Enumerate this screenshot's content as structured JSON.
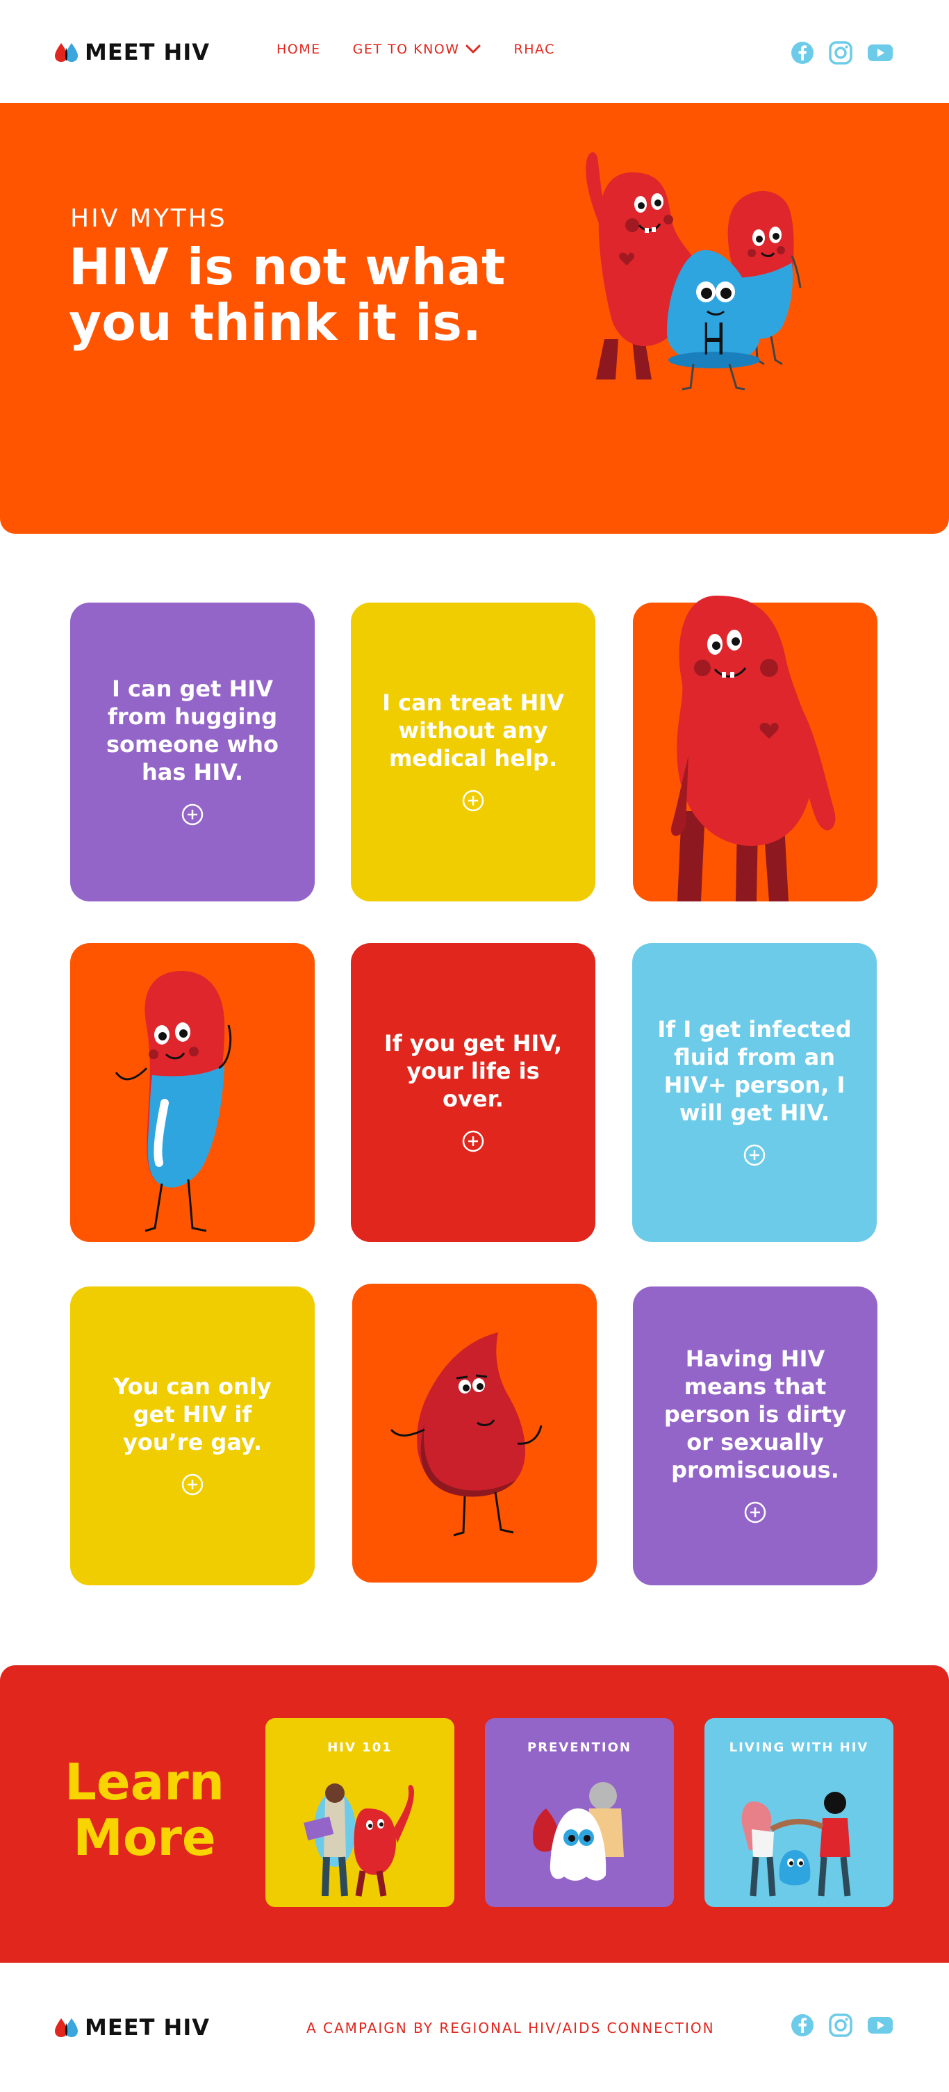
{
  "header": {
    "brand": "MEET HIV",
    "nav": [
      {
        "label": "HOME"
      },
      {
        "label": "GET TO KNOW"
      },
      {
        "label": "RHAC"
      }
    ],
    "social": [
      "facebook-icon",
      "instagram-icon",
      "youtube-icon"
    ]
  },
  "hero": {
    "kicker": "HIV MYTHS",
    "headline": "HIV is not what you think it is."
  },
  "myths": [
    {
      "text": "I can get HIV from hugging someone who has HIV.",
      "color": "#9465c8"
    },
    {
      "text": "I can treat HIV without any medical help.",
      "color": "#f0cd00"
    },
    {
      "text": "If you get HIV, your life is over.",
      "color": "#e0261d"
    },
    {
      "text": "If I get infected fluid from an HIV+ person, I will get HIV.",
      "color": "#6ccbe8"
    },
    {
      "text": "You can only get HIV if you’re gay.",
      "color": "#f0cd00"
    },
    {
      "text": "Having HIV means that person is dirty or sexually promiscuous.",
      "color": "#9465c8"
    }
  ],
  "learn_more": {
    "title": "Learn More",
    "cards": [
      {
        "label": "HIV 101",
        "color": "#f0cd00"
      },
      {
        "label": "PREVENTION",
        "color": "#9465c8"
      },
      {
        "label": "LIVING WITH HIV",
        "color": "#6ccbe8"
      }
    ]
  },
  "footer": {
    "brand": "MEET HIV",
    "tagline": "A CAMPAIGN BY REGIONAL HIV/AIDS CONNECTION"
  },
  "colors": {
    "accent_red": "#e0261d",
    "orange": "#ff5500",
    "purple": "#9465c8",
    "yellow": "#f0cd00",
    "sky": "#6ccbe8",
    "social_blue": "#6ccbe8"
  }
}
